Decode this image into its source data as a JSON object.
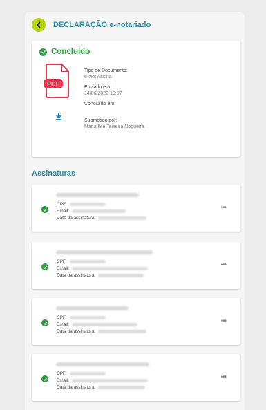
{
  "header": {
    "title": "DECLARAÇÃO e-notariado"
  },
  "document": {
    "status": "Concluído",
    "file_type_icon": "PDF",
    "fields": [
      {
        "label": "Tipo de Documento:",
        "value": "e-Not Assina"
      },
      {
        "label": "Enviado em:",
        "value": "14/06/2022 19:07"
      },
      {
        "label": "Concluído em:",
        "value": ""
      },
      {
        "label": "Submetido por:",
        "value": "Maria Ilse Teixeira Nogueira"
      }
    ]
  },
  "signatures": {
    "title": "Assinaturas",
    "field_labels": {
      "cpf": "CPF:",
      "email": "Email:",
      "date": "Data da assinatura:"
    },
    "more_label": "•••"
  },
  "colors": {
    "accent": "#2a8fa6",
    "success": "#2e9c3f",
    "back": "#b8d20e",
    "pdf": "#e8344e"
  }
}
